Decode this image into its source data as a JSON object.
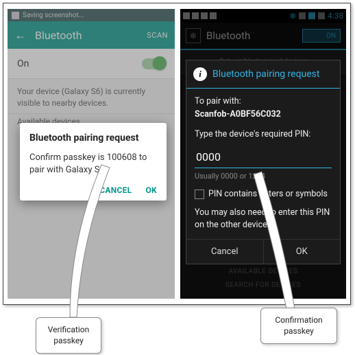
{
  "left": {
    "status": "Saving screenshot...",
    "header": {
      "title": "Bluetooth",
      "scan": "SCAN"
    },
    "on_label": "On",
    "visible_text": "Your device (Galaxy S6) is currently visible to nearby devices.",
    "available": "Available devices",
    "dialog": {
      "title": "Bluetooth pairing request",
      "body": "Confirm passkey is 100608 to pair with Galaxy S5.",
      "cancel": "CANCEL",
      "ok": "OK"
    }
  },
  "right": {
    "clock": "4:38",
    "header": {
      "title": "Bluetooth",
      "toggle": "ON"
    },
    "only_visible": "Only visible to paired devices",
    "dialog": {
      "title": "Bluetooth pairing request",
      "pair_label": "To pair with:",
      "device": "Scanfob-A0BF56C032",
      "type_pin": "Type the device's required PIN:",
      "pin_value": "0000",
      "hint": "Usually 0000 or 1234",
      "checkbox": "PIN contains letters or symbols",
      "note": "You may also need to enter this PIN on the other device.",
      "cancel": "Cancel",
      "ok": "OK"
    },
    "footer1": "AVAILABLE DEVICES",
    "footer2": "SEARCH FOR DEVICES"
  },
  "callouts": {
    "left": "Verification passkey",
    "right": "Confirmation passkey"
  }
}
